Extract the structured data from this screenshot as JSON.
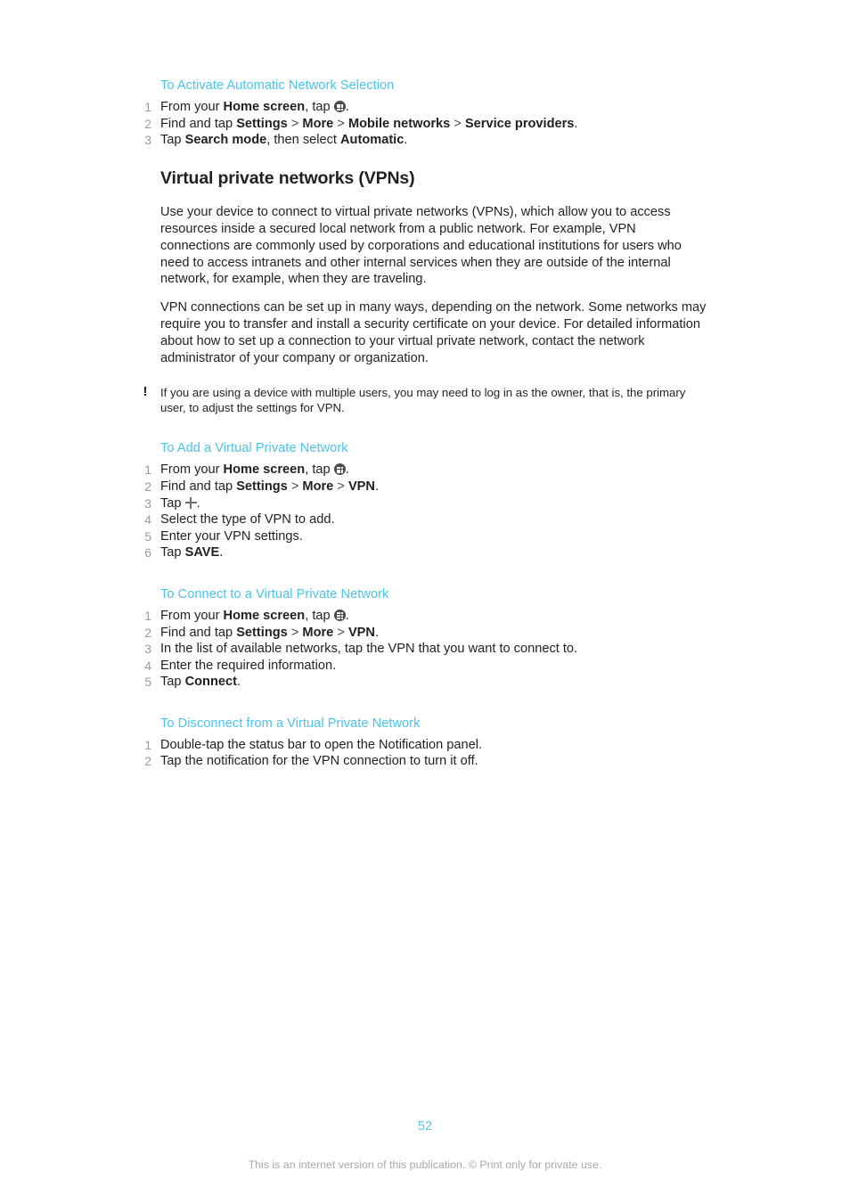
{
  "document": {
    "page_number": "52",
    "footer_note": "This is an internet version of this publication. © Print only for private use."
  },
  "sections": [
    {
      "id": "activate-automatic-network-selection",
      "heading": "To Activate Automatic Network Selection",
      "steps": [
        {
          "parts": [
            {
              "t": "text",
              "v": "From your "
            },
            {
              "t": "bold",
              "v": "Home screen"
            },
            {
              "t": "text",
              "v": ", tap "
            },
            {
              "t": "icon",
              "v": "app-drawer-icon"
            },
            {
              "t": "text",
              "v": "."
            }
          ]
        },
        {
          "parts": [
            {
              "t": "text",
              "v": "Find and tap "
            },
            {
              "t": "bold",
              "v": "Settings"
            },
            {
              "t": "sep",
              "v": " > "
            },
            {
              "t": "bold",
              "v": "More"
            },
            {
              "t": "sep",
              "v": " > "
            },
            {
              "t": "bold",
              "v": "Mobile networks"
            },
            {
              "t": "sep",
              "v": " > "
            },
            {
              "t": "bold",
              "v": "Service providers"
            },
            {
              "t": "text",
              "v": "."
            }
          ]
        },
        {
          "parts": [
            {
              "t": "text",
              "v": "Tap "
            },
            {
              "t": "bold",
              "v": "Search mode"
            },
            {
              "t": "text",
              "v": ", then select "
            },
            {
              "t": "bold",
              "v": "Automatic"
            },
            {
              "t": "text",
              "v": "."
            }
          ]
        }
      ]
    }
  ],
  "main_heading": "Virtual private networks (VPNs)",
  "paragraphs": [
    "Use your device to connect to virtual private networks (VPNs), which allow you to access resources inside a secured local network from a public network. For example, VPN connections are commonly used by corporations and educational institutions for users who need to access intranets and other internal services when they are outside of the internal network, for example, when they are traveling.",
    "VPN connections can be set up in many ways, depending on the network. Some networks may require you to transfer and install a security certificate on your device. For detailed information about how to set up a connection to your virtual private network, contact the network administrator of your company or organization."
  ],
  "note": {
    "icon": "exclamation-icon",
    "icon_glyph": "!",
    "text": "If you are using a device with multiple users, you may need to log in as the owner, that is, the primary user, to adjust the settings for VPN."
  },
  "procedures": [
    {
      "id": "add-a-virtual-private-network",
      "heading": "To Add a Virtual Private Network",
      "steps": [
        {
          "parts": [
            {
              "t": "text",
              "v": "From your "
            },
            {
              "t": "bold",
              "v": "Home screen"
            },
            {
              "t": "text",
              "v": ", tap "
            },
            {
              "t": "icon",
              "v": "app-drawer-icon"
            },
            {
              "t": "text",
              "v": "."
            }
          ]
        },
        {
          "parts": [
            {
              "t": "text",
              "v": "Find and tap "
            },
            {
              "t": "bold",
              "v": "Settings"
            },
            {
              "t": "sep",
              "v": " > "
            },
            {
              "t": "bold",
              "v": "More"
            },
            {
              "t": "sep",
              "v": " > "
            },
            {
              "t": "bold",
              "v": "VPN"
            },
            {
              "t": "text",
              "v": "."
            }
          ]
        },
        {
          "parts": [
            {
              "t": "text",
              "v": "Tap "
            },
            {
              "t": "icon",
              "v": "plus-icon"
            },
            {
              "t": "text",
              "v": "."
            }
          ]
        },
        {
          "parts": [
            {
              "t": "text",
              "v": "Select the type of VPN to add."
            }
          ]
        },
        {
          "parts": [
            {
              "t": "text",
              "v": "Enter your VPN settings."
            }
          ]
        },
        {
          "parts": [
            {
              "t": "text",
              "v": "Tap "
            },
            {
              "t": "bold",
              "v": "SAVE"
            },
            {
              "t": "text",
              "v": "."
            }
          ]
        }
      ]
    },
    {
      "id": "connect-to-a-virtual-private-network",
      "heading": "To Connect to a Virtual Private Network",
      "steps": [
        {
          "parts": [
            {
              "t": "text",
              "v": "From your "
            },
            {
              "t": "bold",
              "v": "Home screen"
            },
            {
              "t": "text",
              "v": ", tap "
            },
            {
              "t": "icon",
              "v": "app-drawer-icon"
            },
            {
              "t": "text",
              "v": "."
            }
          ]
        },
        {
          "parts": [
            {
              "t": "text",
              "v": "Find and tap "
            },
            {
              "t": "bold",
              "v": "Settings"
            },
            {
              "t": "sep",
              "v": " > "
            },
            {
              "t": "bold",
              "v": "More"
            },
            {
              "t": "sep",
              "v": " > "
            },
            {
              "t": "bold",
              "v": "VPN"
            },
            {
              "t": "text",
              "v": "."
            }
          ]
        },
        {
          "parts": [
            {
              "t": "text",
              "v": "In the list of available networks, tap the VPN that you want to connect to."
            }
          ]
        },
        {
          "parts": [
            {
              "t": "text",
              "v": "Enter the required information."
            }
          ]
        },
        {
          "parts": [
            {
              "t": "text",
              "v": "Tap "
            },
            {
              "t": "bold",
              "v": "Connect"
            },
            {
              "t": "text",
              "v": "."
            }
          ]
        }
      ]
    },
    {
      "id": "disconnect-from-a-virtual-private-network",
      "heading": "To Disconnect from a Virtual Private Network",
      "steps": [
        {
          "parts": [
            {
              "t": "text",
              "v": "Double-tap the status bar to open the Notification panel."
            }
          ]
        },
        {
          "parts": [
            {
              "t": "text",
              "v": "Tap the notification for the VPN connection to turn it off."
            }
          ]
        }
      ]
    }
  ],
  "colors": {
    "heading_accent": "#4cc3e9",
    "body_text": "#231f20",
    "step_number": "#9b9b9b",
    "footer_text": "#a8a8a8",
    "page_number": "#5fc5e8"
  }
}
